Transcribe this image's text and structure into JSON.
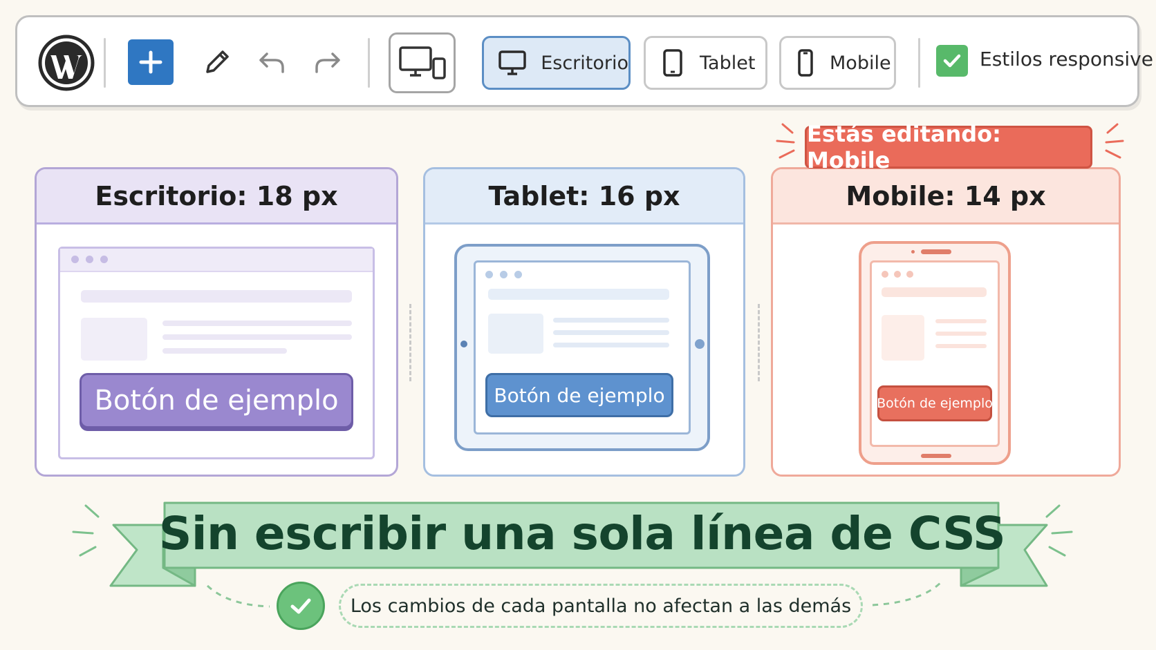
{
  "toolbar": {
    "wp_logo_icon": "wordpress-icon",
    "add_icon": "plus-icon",
    "edit_icon": "pencil-icon",
    "undo_icon": "undo-icon",
    "redo_icon": "redo-icon",
    "responsive_toggle_icon": "devices-icon",
    "device_buttons": [
      {
        "label": "Escritorio",
        "icon": "desktop-icon",
        "active": true
      },
      {
        "label": "Tablet",
        "icon": "tablet-icon",
        "active": false
      },
      {
        "label": "Mobile",
        "icon": "mobile-icon",
        "active": false
      }
    ],
    "responsive_styles": {
      "label": "Estilos responsive",
      "checked": true
    }
  },
  "editing_badge": "Estás editando: Mobile",
  "panels": [
    {
      "title": "Escritorio: 18 px",
      "button_label": "Botón de ejemplo",
      "accent": "#9a88cf"
    },
    {
      "title": "Tablet: 16 px",
      "button_label": "Botón de ejemplo",
      "accent": "#5e92cf"
    },
    {
      "title": "Mobile: 14 px",
      "button_label": "Botón de ejemplo",
      "accent": "#e8705e"
    }
  ],
  "banner": {
    "title": "Sin escribir una sola línea de CSS",
    "note": "Los cambios de cada pantalla no afectan a las demás",
    "accent": "#6cc27c"
  }
}
